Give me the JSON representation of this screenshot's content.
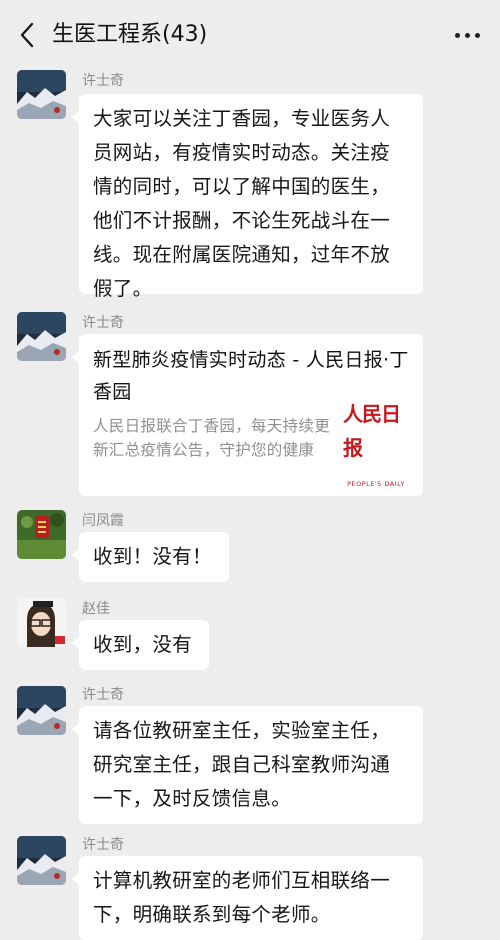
{
  "header": {
    "title": "生医工程系(43)"
  },
  "messages": [
    {
      "sender": "许士奇",
      "text": "大家可以关注丁香园，专业医务人员网站，有疫情实时动态。关注疫情的同时，可以了解中国的医生，他们不计报酬，不论生死战斗在一线。现在附属医院通知，过年不放假了。"
    },
    {
      "sender": "许士奇",
      "card": {
        "title": "新型肺炎疫情实时动态 - 人民日报·丁香园",
        "desc": "人民日报联合丁香园，每天持续更新汇总疫情公告，守护您的健康",
        "thumb_logo": "人民日报",
        "thumb_sub": "PEOPLE'S DAILY"
      }
    },
    {
      "sender": "闫凤霞",
      "text": "收到！没有！"
    },
    {
      "sender": "赵佳",
      "text": "收到，没有"
    },
    {
      "sender": "许士奇",
      "text": "请各位教研室主任，实验室主任，研究室主任，跟自己科室教师沟通一下，及时反馈信息。"
    },
    {
      "sender": "许士奇",
      "text": "计算机教研室的老师们互相联络一下，明确联系到每个老师。"
    }
  ],
  "colors": {
    "background": "#ededed",
    "bubble": "#ffffff",
    "sender": "#8a8a8a",
    "brand_red": "#c8161d"
  },
  "icons": {
    "back": "chevron-left-icon",
    "more": "more-dots-icon"
  }
}
